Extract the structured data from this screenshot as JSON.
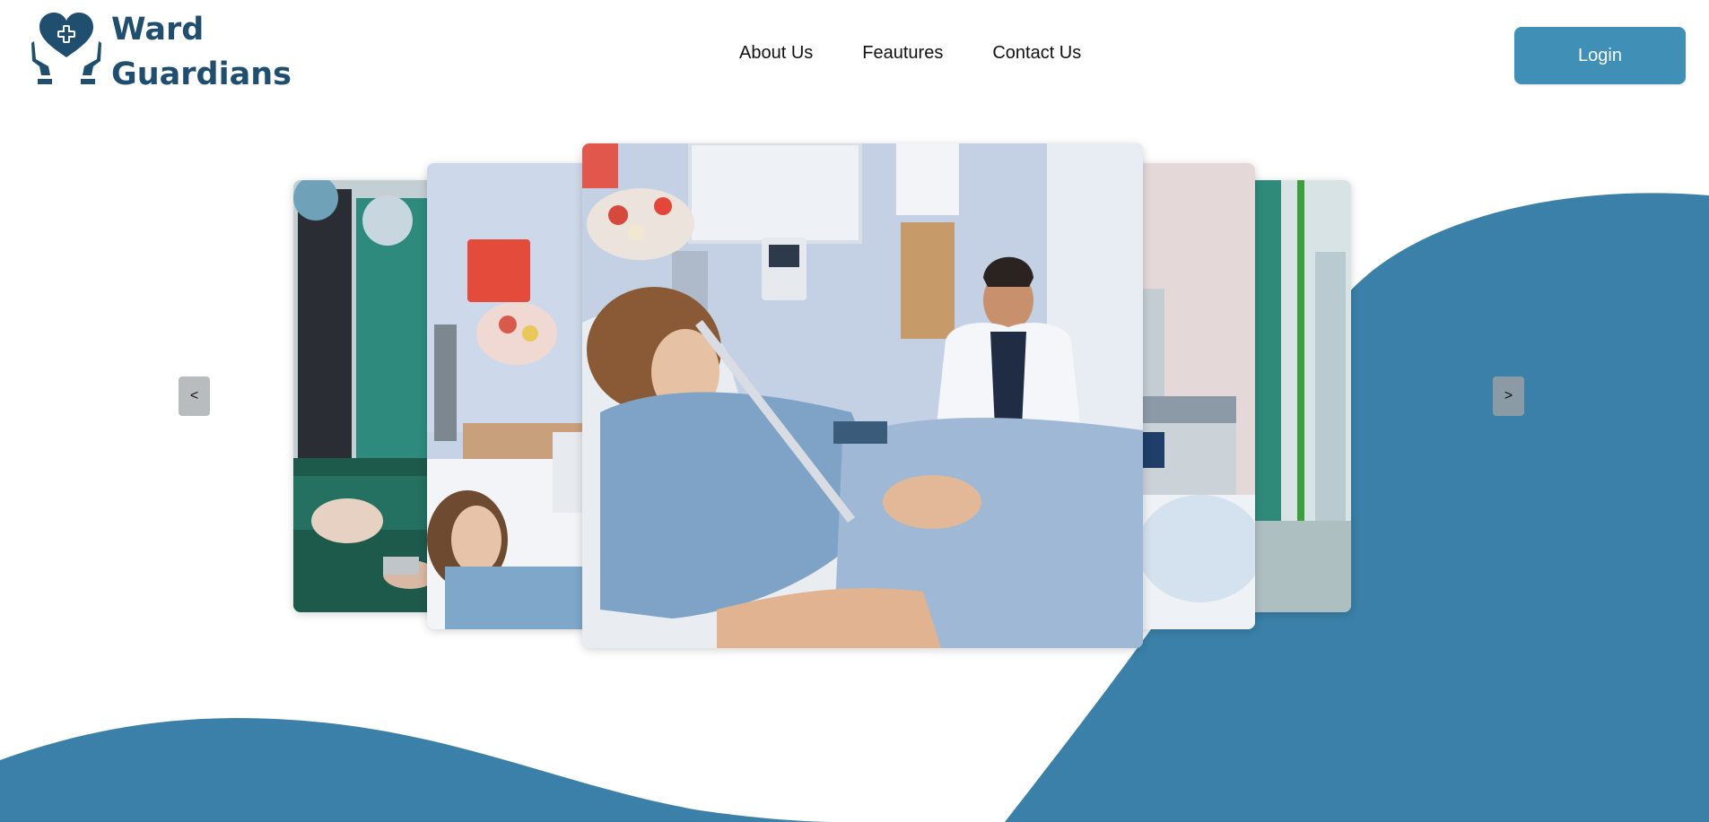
{
  "brand": {
    "line1": "Ward",
    "line2": "Guardians",
    "logo_icon": "heart-hands-medical-cross-icon"
  },
  "nav": {
    "items": [
      {
        "label": "About Us"
      },
      {
        "label": "Feautures"
      },
      {
        "label": "Contact Us"
      }
    ]
  },
  "login": {
    "label": "Login"
  },
  "carousel": {
    "prev_label": "<",
    "next_label": ">",
    "slides": [
      {
        "description_icon": "surgery-photo"
      },
      {
        "description_icon": "patient-in-bed-photo"
      },
      {
        "description_icon": "doctor-talking-to-patient-photo"
      },
      {
        "description_icon": "hospital-equipment-photo"
      },
      {
        "description_icon": "hospital-corridor-photo"
      }
    ]
  },
  "colors": {
    "brand": "#1f4e6e",
    "accent": "#3f8fb6",
    "wave": "#3a80a8"
  }
}
